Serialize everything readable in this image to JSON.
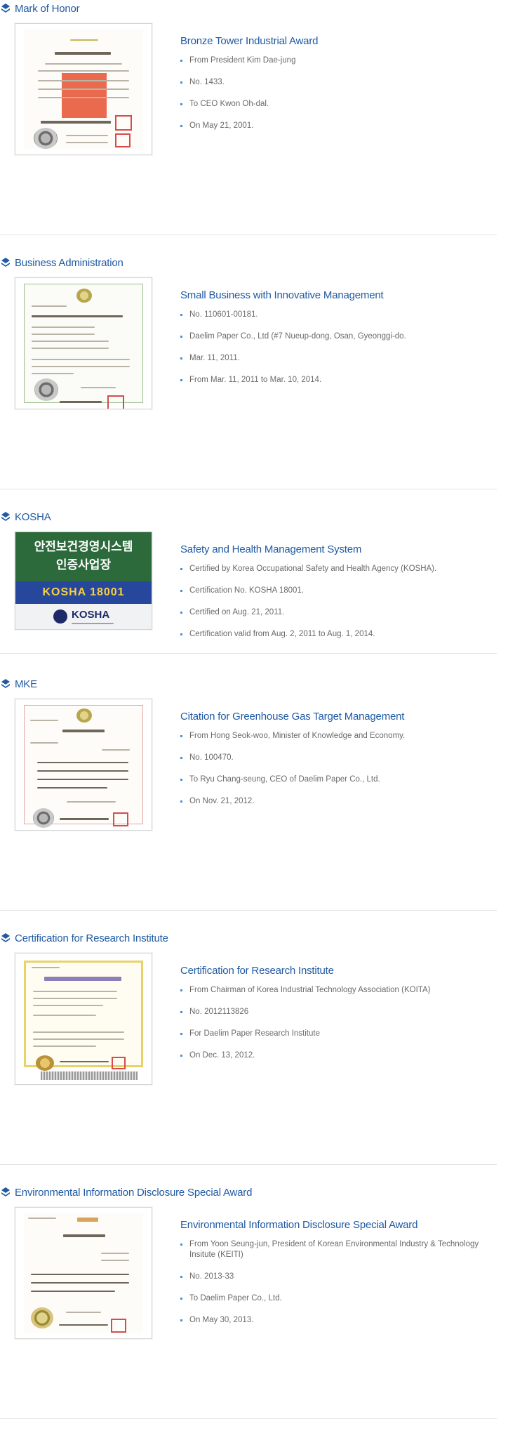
{
  "sections": [
    {
      "heading": "Mark of Honor",
      "title": "Bronze Tower Industrial Award",
      "items": [
        "From President Kim Dae-jung",
        "No. 1433.",
        "To CEO Kwon Oh-dal.",
        "On May 21, 2001."
      ]
    },
    {
      "heading": "Business Administration",
      "title": "Small Business with Innovative Management",
      "items": [
        "No. 110601-00181.",
        "Daelim Paper Co., Ltd (#7 Nueup-dong, Osan, Gyeonggi-do.",
        "Mar. 11, 2011.",
        "From Mar. 11, 2011 to Mar. 10, 2014."
      ]
    },
    {
      "heading": "KOSHA",
      "title": "Safety and Health Management System",
      "items": [
        "Certified by Korea Occupational Safety and Health Agency (KOSHA).",
        "Certification No. KOSHA 18001.",
        "Certified on Aug. 21, 2011.",
        "Certification valid from Aug. 2, 2011 to Aug. 1, 2014."
      ],
      "badge": {
        "line1": "안전보건경영시스템",
        "line2": "인증사업장",
        "code": "KOSHA 18001",
        "logo": "KOSHA"
      }
    },
    {
      "heading": "MKE",
      "title": "Citation for Greenhouse Gas Target Management",
      "items": [
        "From Hong Seok-woo, Minister of Knowledge and Economy.",
        "No. 100470.",
        "To Ryu Chang-seung, CEO of Daelim Paper Co., Ltd.",
        "On Nov. 21, 2012."
      ]
    },
    {
      "heading": "Certification for Research Institute",
      "title": "Certification for Research Institute",
      "items": [
        "From Chairman of Korea Industrial Technology Association (KOITA)",
        "No. 2012113826",
        "For Daelim Paper Research Institute",
        "On Dec. 13, 2012."
      ]
    },
    {
      "heading": "Environmental Information Disclosure Special Award",
      "title": "Environmental Information Disclosure Special Award",
      "items": [
        "From Yoon Seung-jun, President of Korean Environmental Industry & Technology Insitute (KEITI)",
        "No. 2013-33",
        "To Daelim Paper Co., Ltd.",
        "On May 30, 2013."
      ]
    }
  ],
  "colors": {
    "heading": "#1f5aa3",
    "bullet": "#4a8fd8",
    "text": "#6a6a6a"
  },
  "icons": {
    "section_bullet": "stacked-diamond-icon"
  }
}
